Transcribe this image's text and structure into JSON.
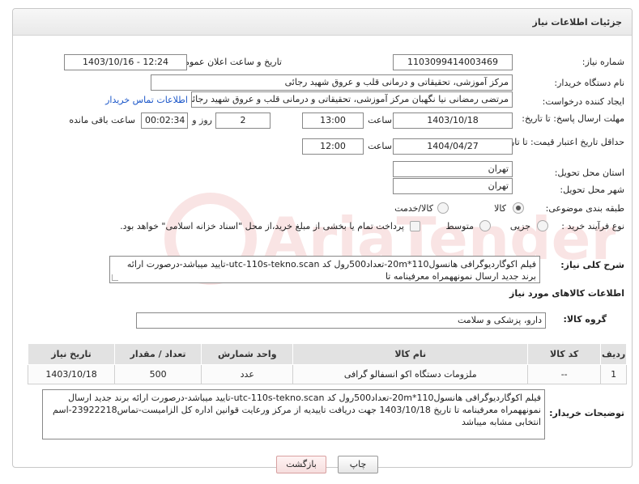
{
  "header": {
    "title": "جزئیات اطلاعات نیاز"
  },
  "form": {
    "need_number": {
      "label": "شماره نیاز:",
      "value": "1103099414003469"
    },
    "announce_datetime": {
      "label": "تاریخ و ساعت اعلان عمومی:",
      "value": "1403/10/16 - 12:24"
    },
    "buyer_org": {
      "label": "نام دستگاه خریدار:",
      "value": "مرکز آموزشی، تحقیقاتی و درمانی قلب و عروق شهید رجائی"
    },
    "requester": {
      "label": "ایجاد کننده درخواست:",
      "value": "مرتضی رمضانی نیا نگهبان مرکز آموزشی، تحقیقاتی و درمانی قلب و عروق شهید رجائی",
      "contact_link": "اطلاعات تماس خریدار"
    },
    "reply_deadline": {
      "label": "مهلت ارسال پاسخ: تا تاریخ:",
      "date": "1403/10/18",
      "time_label": "ساعت",
      "time": "13:00",
      "days": "2",
      "days_label": "روز و",
      "remaining": "00:02:34",
      "remaining_label": "ساعت باقی مانده"
    },
    "price_validity": {
      "label": "حداقل تاریخ اعتبار قیمت: تا تاریخ:",
      "date": "1404/04/27",
      "time_label": "ساعت",
      "time": "12:00"
    },
    "delivery_province": {
      "label": "استان محل تحویل:",
      "value": "تهران"
    },
    "delivery_city": {
      "label": "شهر محل تحویل:",
      "value": "تهران"
    },
    "category": {
      "label": "طبقه بندی موضوعی:",
      "options": [
        "کالا",
        "کالا/خدمت"
      ],
      "selected": "کالا"
    },
    "purchase_process": {
      "label": "نوع فرآیند خرید :",
      "options": [
        "جزیی",
        "متوسط"
      ],
      "note": "پرداخت تمام یا بخشی از مبلغ خرید،از محل \"اسناد خزانه اسلامی\" خواهد بود."
    },
    "general_description": {
      "label": "شرح کلی نیاز:",
      "value": "فیلم اکوگاردیوگرافی هانسول110*20m-تعداد500رول کد utc-110s-tekno.scan-تایید میباشد-درصورت ارائه برند جدید ارسال نمونههمراه معرفینامه تا"
    },
    "goods_info_title": "اطلاعات کالاهای مورد نیاز",
    "goods_group": {
      "label": "گروه کالا:",
      "value": "دارو، پزشکی و سلامت"
    }
  },
  "table": {
    "headers": [
      "ردیف",
      "کد کالا",
      "نام کالا",
      "واحد شمارش",
      "تعداد / مقدار",
      "تاریخ نیاز"
    ],
    "rows": [
      [
        "1",
        "--",
        "ملزومات دستگاه اکو انسفالو گرافی",
        "عدد",
        "500",
        "1403/10/18"
      ]
    ]
  },
  "buyer_notes": {
    "label": "توضیحات خریدار:",
    "value": "فیلم اکوگاردیوگرافی هانسول110*20m-تعداد500رول کد utc-110s-tekno.scan-تایید میباشد-درصورت ارائه برند جدید ارسال نمونههمراه معرفینامه تا تاریخ 1403/10/18 جهت دریافت تاییدیه از مرکز ورعایت قوانین اداره کل الزامیست-تماس23922218-اسم انتخابی مشابه میباشد"
  },
  "buttons": {
    "print": "چاپ",
    "back": "بازگشت"
  },
  "watermark": "AriaTender.neT"
}
